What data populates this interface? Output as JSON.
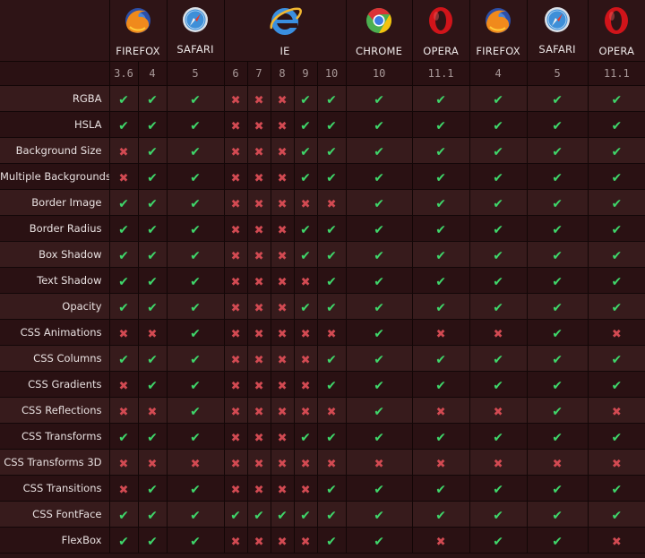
{
  "browser_groups": [
    {
      "name": "FIREFOX",
      "icon": "firefox-icon",
      "versions": [
        "3.6",
        "4"
      ]
    },
    {
      "name": "SAFARI",
      "icon": "safari-icon",
      "versions": [
        "5"
      ]
    },
    {
      "name": "IE",
      "icon": "ie-icon",
      "versions": [
        "6",
        "7",
        "8",
        "9",
        "10"
      ]
    },
    {
      "name": "CHROME",
      "icon": "chrome-icon",
      "versions": [
        "10"
      ]
    },
    {
      "name": "OPERA",
      "icon": "opera-icon",
      "versions": [
        "11.1"
      ]
    },
    {
      "name": "FIREFOX",
      "icon": "firefox-icon",
      "versions": [
        "4"
      ]
    },
    {
      "name": "SAFARI",
      "icon": "safari-icon",
      "versions": [
        "5"
      ]
    },
    {
      "name": "OPERA",
      "icon": "opera-icon",
      "versions": [
        "11.1"
      ]
    }
  ],
  "symbols": {
    "yes": "✔",
    "no": "✖"
  },
  "features": [
    {
      "name": "RGBA",
      "support": [
        1,
        1,
        1,
        0,
        0,
        0,
        1,
        1,
        1,
        1,
        1,
        1,
        1
      ]
    },
    {
      "name": "HSLA",
      "support": [
        1,
        1,
        1,
        0,
        0,
        0,
        1,
        1,
        1,
        1,
        1,
        1,
        1
      ]
    },
    {
      "name": "Background Size",
      "support": [
        0,
        1,
        1,
        0,
        0,
        0,
        1,
        1,
        1,
        1,
        1,
        1,
        1
      ]
    },
    {
      "name": "Multiple Backgrounds",
      "support": [
        0,
        1,
        1,
        0,
        0,
        0,
        1,
        1,
        1,
        1,
        1,
        1,
        1
      ]
    },
    {
      "name": "Border Image",
      "support": [
        1,
        1,
        1,
        0,
        0,
        0,
        0,
        0,
        1,
        1,
        1,
        1,
        1
      ]
    },
    {
      "name": "Border Radius",
      "support": [
        1,
        1,
        1,
        0,
        0,
        0,
        1,
        1,
        1,
        1,
        1,
        1,
        1
      ]
    },
    {
      "name": "Box Shadow",
      "support": [
        1,
        1,
        1,
        0,
        0,
        0,
        1,
        1,
        1,
        1,
        1,
        1,
        1
      ]
    },
    {
      "name": "Text Shadow",
      "support": [
        1,
        1,
        1,
        0,
        0,
        0,
        0,
        1,
        1,
        1,
        1,
        1,
        1
      ]
    },
    {
      "name": "Opacity",
      "support": [
        1,
        1,
        1,
        0,
        0,
        0,
        1,
        1,
        1,
        1,
        1,
        1,
        1
      ]
    },
    {
      "name": "CSS Animations",
      "support": [
        0,
        0,
        1,
        0,
        0,
        0,
        0,
        0,
        1,
        0,
        0,
        1,
        0
      ]
    },
    {
      "name": "CSS Columns",
      "support": [
        1,
        1,
        1,
        0,
        0,
        0,
        0,
        1,
        1,
        1,
        1,
        1,
        1
      ]
    },
    {
      "name": "CSS Gradients",
      "support": [
        0,
        1,
        1,
        0,
        0,
        0,
        0,
        1,
        1,
        1,
        1,
        1,
        1
      ]
    },
    {
      "name": "CSS Reflections",
      "support": [
        0,
        0,
        1,
        0,
        0,
        0,
        0,
        0,
        1,
        0,
        0,
        1,
        0
      ]
    },
    {
      "name": "CSS Transforms",
      "support": [
        1,
        1,
        1,
        0,
        0,
        0,
        1,
        1,
        1,
        1,
        1,
        1,
        1
      ]
    },
    {
      "name": "CSS Transforms 3D",
      "support": [
        0,
        0,
        0,
        0,
        0,
        0,
        0,
        0,
        0,
        0,
        0,
        0,
        0
      ]
    },
    {
      "name": "CSS Transitions",
      "support": [
        0,
        1,
        1,
        0,
        0,
        0,
        0,
        1,
        1,
        1,
        1,
        1,
        1
      ]
    },
    {
      "name": "CSS FontFace",
      "support": [
        1,
        1,
        1,
        1,
        1,
        1,
        1,
        1,
        1,
        1,
        1,
        1,
        1
      ]
    },
    {
      "name": "FlexBox",
      "support": [
        1,
        1,
        1,
        0,
        0,
        0,
        0,
        1,
        1,
        0,
        1,
        1,
        0
      ]
    }
  ]
}
